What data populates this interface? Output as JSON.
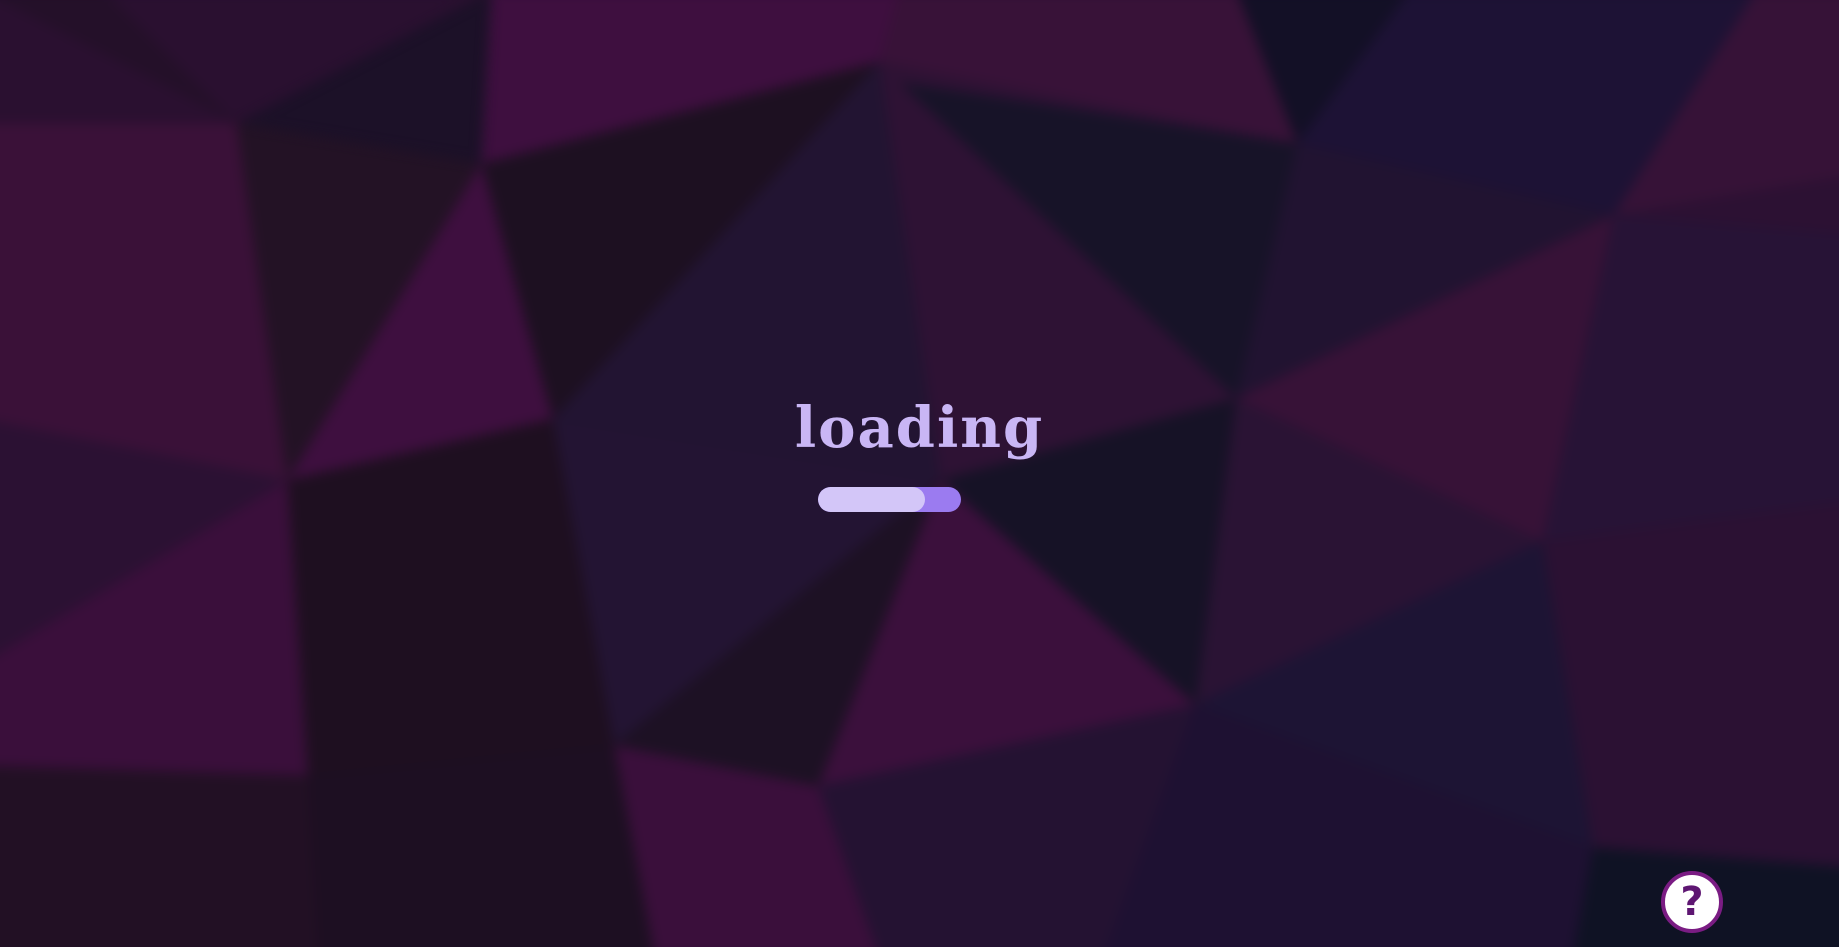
{
  "loading": {
    "label": "loading",
    "progress_fraction": 0.75
  },
  "help": {
    "icon": "question-mark-icon",
    "glyph": "?"
  },
  "colors": {
    "text": "#c9b6f5",
    "progress_fill": "#d3c6f8",
    "progress_track": "#9b7bf0",
    "help_border": "#7a1c83",
    "background_dark": "#1c1128",
    "background_magenta": "#3e0f3f"
  }
}
